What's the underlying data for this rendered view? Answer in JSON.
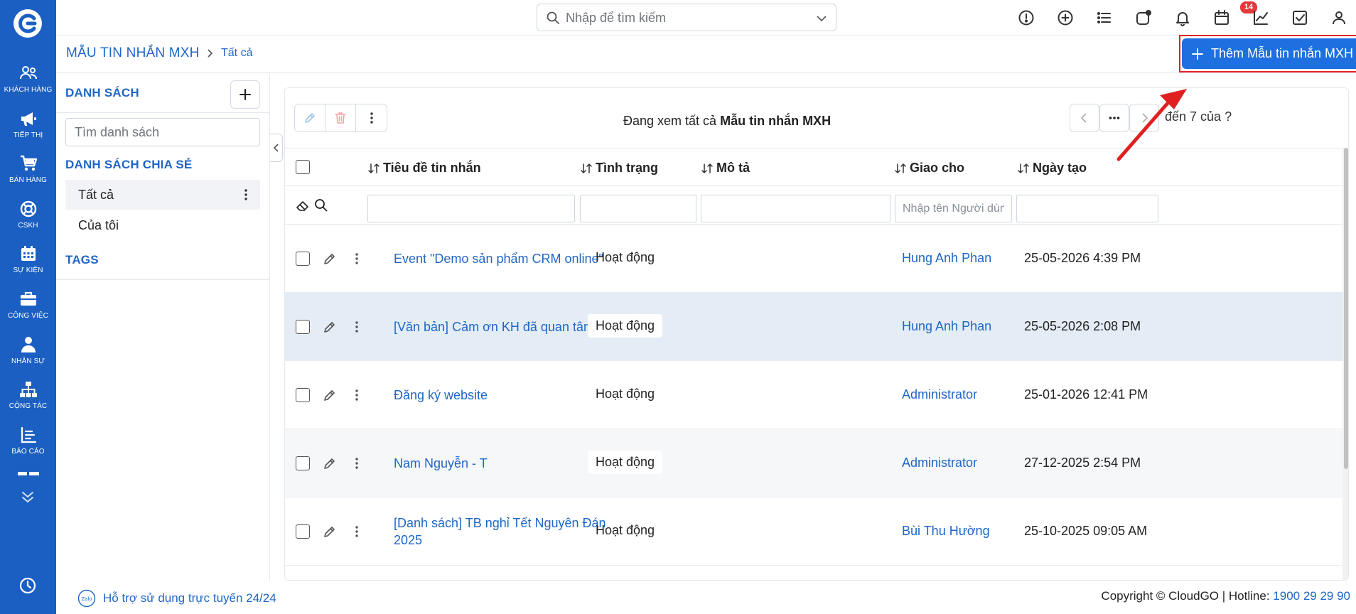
{
  "sidenav": {
    "items": [
      {
        "label": "Khách hàng",
        "icon": "users-icon"
      },
      {
        "label": "Tiếp thị",
        "icon": "megaphone-icon"
      },
      {
        "label": "Bán hàng",
        "icon": "cart-icon"
      },
      {
        "label": "CSKH",
        "icon": "lifebuoy-icon"
      },
      {
        "label": "Sự kiện",
        "icon": "calendar-icon"
      },
      {
        "label": "Công việc",
        "icon": "briefcase-icon"
      },
      {
        "label": "Nhân sự",
        "icon": "person-icon"
      },
      {
        "label": "Cộng tác",
        "icon": "org-chart-icon"
      },
      {
        "label": "Báo cáo",
        "icon": "report-icon"
      }
    ]
  },
  "topbar": {
    "search_placeholder": "Nhập để tìm kiếm",
    "notification_count": "14",
    "colors": {
      "brand": "#1b5fc2",
      "primary_button": "#1e6fe0",
      "badge": "#e5383b"
    }
  },
  "header": {
    "module_title": "MẪU TIN NHẮN MXH",
    "breadcrumb_current": "Tất cả",
    "add_button_label": "Thêm Mẫu tin nhắn MXH"
  },
  "list_panel": {
    "heading": "DANH SÁCH",
    "search_placeholder": "Tìm danh sách",
    "shared_heading": "DANH SÁCH CHIA SẺ",
    "items": [
      "Tất cả",
      "Của tôi"
    ],
    "tags_heading": "TAGS"
  },
  "main": {
    "viewing_prefix": "Đang xem tất cả",
    "viewing_module": "Mẫu tin nhắn MXH",
    "pager_text": "đến 7 của",
    "pager_unknown": "?"
  },
  "table": {
    "columns": [
      "Tiêu đề tin nhắn",
      "Tình trạng",
      "Mô tả",
      "Giao cho",
      "Ngày tạo"
    ],
    "filter_assignee_placeholder": "Nhập tên Người dùng ho",
    "rows": [
      {
        "title": "Event \"Demo sản phẩm CRM online\"",
        "status": "Hoạt động",
        "description": "",
        "assignee": "Hung Anh Phan",
        "created": "25-05-2026 4:39 PM"
      },
      {
        "title": "[Văn bản] Cảm ơn KH đã quan tâm OA",
        "status": "Hoạt động",
        "description": "",
        "assignee": "Hung Anh Phan",
        "created": "25-05-2026 2:08 PM"
      },
      {
        "title": "Đăng ký website",
        "status": "Hoạt động",
        "description": "",
        "assignee": "Administrator",
        "created": "25-01-2026 12:41 PM"
      },
      {
        "title": "Nam Nguyễn - T",
        "status": "Hoạt động",
        "description": "",
        "assignee": "Administrator",
        "created": "27-12-2025 2:54 PM"
      },
      {
        "title": "[Danh sách] TB nghỉ Tết Nguyên Đán 2025",
        "status": "Hoạt động",
        "description": "",
        "assignee": "Bùi Thu Hường",
        "created": "25-10-2025 09:05 AM"
      }
    ]
  },
  "footer": {
    "support_text": "Hỗ trợ sử dụng trực tuyến 24/24",
    "copyright": "Copyright © CloudGO",
    "hotline_label": "Hotline:",
    "hotline_number": "1900 29 29 90"
  }
}
